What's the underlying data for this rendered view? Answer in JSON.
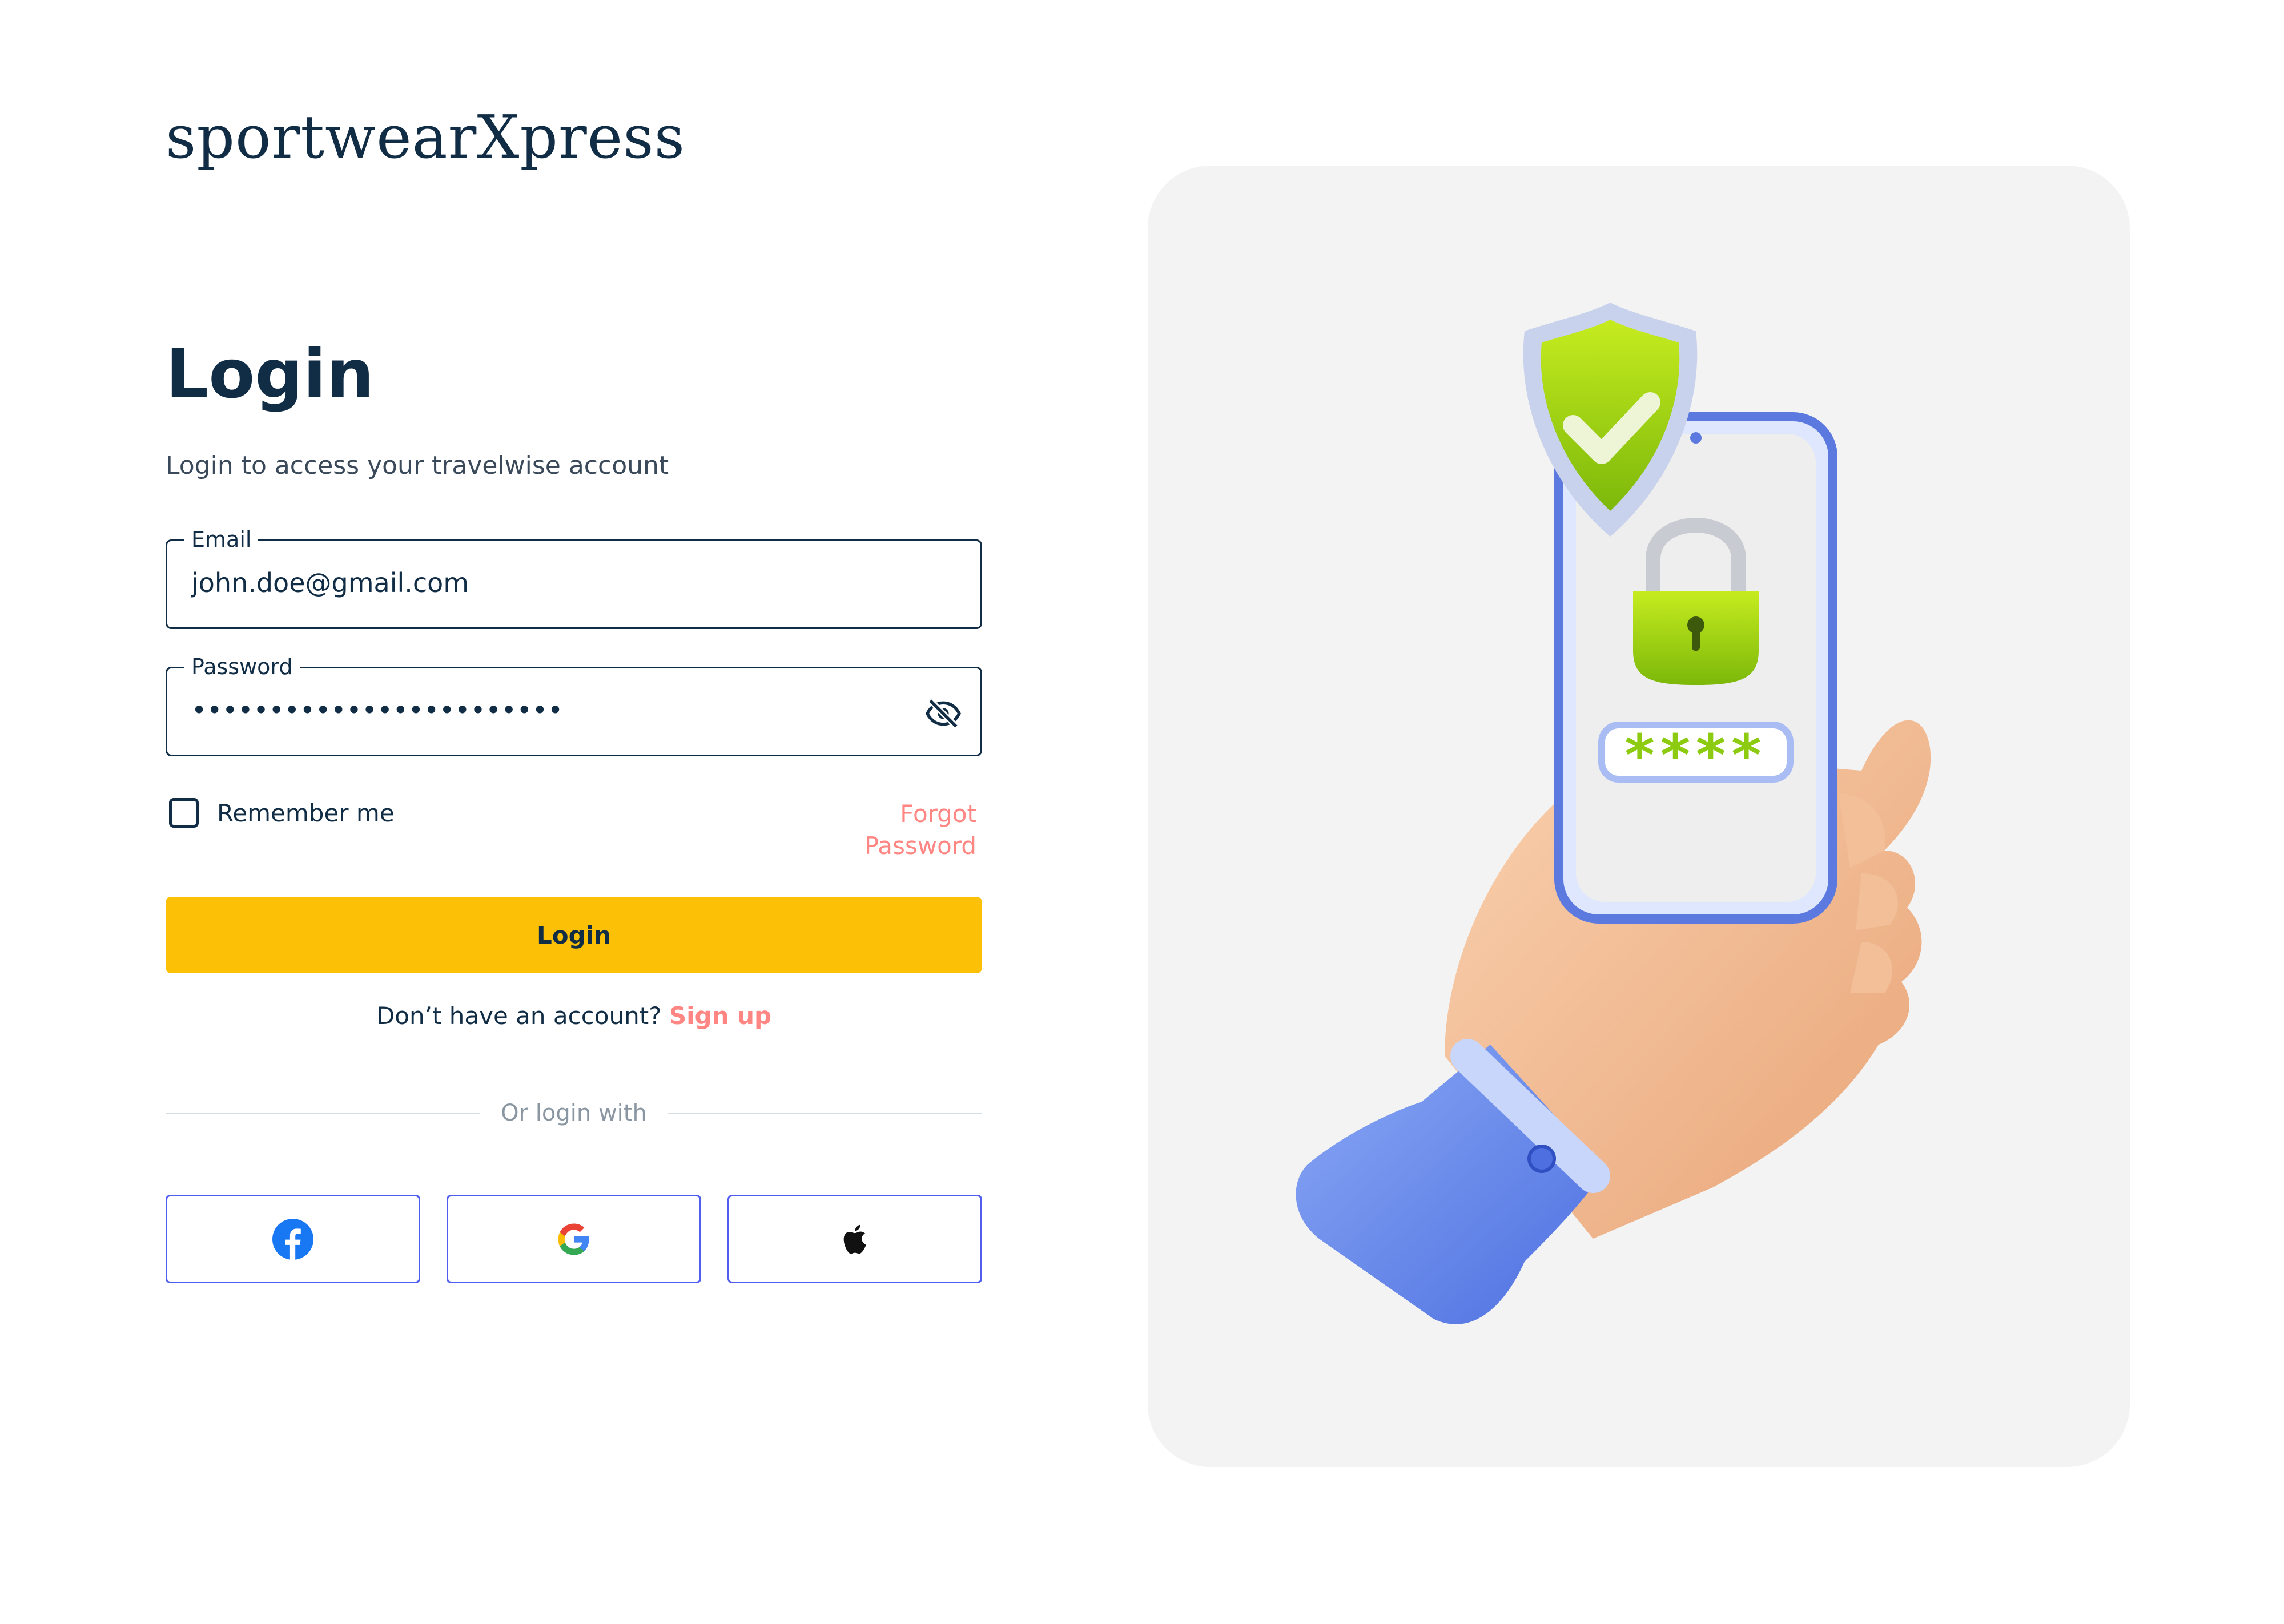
{
  "brand": {
    "logo_text": "sportwearXpress"
  },
  "login_form": {
    "heading": "Login",
    "subtitle": "Login to access your travelwise  account",
    "email": {
      "label": "Email",
      "value": "john.doe@gmail.com"
    },
    "password": {
      "label": "Password",
      "value": "••••••••••••••••••••••••",
      "toggle_icon": "eye-off-icon"
    },
    "remember_me_label": "Remember me",
    "remember_me_checked": false,
    "forgot_password_label": "Forgot Password",
    "submit_label": "Login",
    "signup_prompt": "Don’t have an account?",
    "signup_link": "Sign up",
    "divider_text": "Or login with",
    "social_providers": [
      "facebook-icon",
      "google-icon",
      "apple-icon"
    ]
  },
  "illustration": {
    "password_chars": "****"
  },
  "colors": {
    "primary_text": "#112d45",
    "accent_link": "#ff8682",
    "button": "#fcc107",
    "social_border": "#515def",
    "panel_bg": "#f3f3f3"
  }
}
